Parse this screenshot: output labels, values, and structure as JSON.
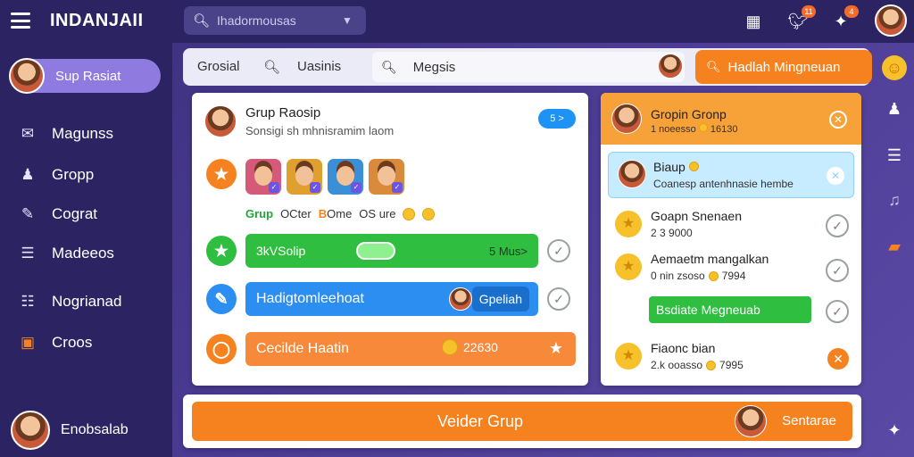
{
  "app": {
    "title": "INDANJAII"
  },
  "topbar": {
    "search_placeholder": "Ihadormousas",
    "badges": {
      "twitter": "11",
      "puzzle": "4"
    }
  },
  "sidebar": {
    "user_name": "Sup Rasiat",
    "items": [
      {
        "label": "Magunss",
        "icon": "chat-icon"
      },
      {
        "label": "Gropp",
        "icon": "person-icon"
      },
      {
        "label": "Cograt",
        "icon": "edit-icon"
      },
      {
        "label": "Madeeos",
        "icon": "folder-icon"
      },
      {
        "label": "Nogrianad",
        "icon": "grid-icon"
      },
      {
        "label": "Croos",
        "icon": "chest-icon"
      }
    ],
    "bottom_user": "Enobsalab"
  },
  "content": {
    "tabs": [
      "Grosial",
      "Uasinis"
    ],
    "search_value": "Megsis",
    "orange_button": "Hadlah Mingneuan"
  },
  "group_panel": {
    "title": "Grup Raosip",
    "subtitle": "Sonsigi sh mhnisramim laom",
    "toggle": "5 >",
    "meta": {
      "green": "Grup",
      "a": "OCter",
      "orange": "B",
      "b": "Ome",
      "c": "OS ure"
    },
    "green_bar": {
      "left": "3kVSolip",
      "right": "5 Mus>"
    },
    "blue_bar": {
      "label": "Hadigtomleehoat",
      "chip": "Gpeliah"
    },
    "orange_bar": {
      "label": "Cecilde Haatin",
      "amount": "22630"
    }
  },
  "right_panel": {
    "head_title": "Gropin Gronp",
    "head_sub": "1 noeesso",
    "head_amount": "16130",
    "card_title": "Biaup",
    "card_sub": "Coanesp antenhnasie hembe",
    "rows": [
      {
        "title": "Goapn Snenaen",
        "sub": "2 3 9000"
      },
      {
        "title": "Aemaetm mangalkan",
        "sub": "0 nin zsoso",
        "amount": "7994"
      },
      {
        "title": "Fiaonc bian",
        "sub": "2.k ooasso",
        "amount": "7995"
      }
    ],
    "green_button": "Bsdiate Megneuab"
  },
  "cta": {
    "label": "Veider Grup",
    "right": "Sentarae"
  }
}
